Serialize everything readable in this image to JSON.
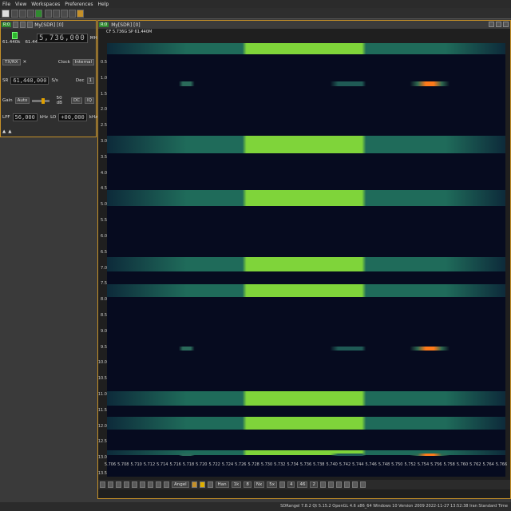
{
  "menu": [
    "File",
    "View",
    "Workspaces",
    "Preferences",
    "Help"
  ],
  "device": {
    "title": "My[SDR] [0]",
    "freq_left": "61.440k",
    "freq_right": "61.440k",
    "frequency": "5,736,000",
    "freq_unit": "MHz",
    "mode": "TX/RX",
    "clock_label": "Clock",
    "clock_value": "Internal",
    "sr_label": "SR",
    "sr_value": "61,440,000",
    "sr_unit": "S/s",
    "dec_label": "Dec",
    "dec_value": "1",
    "gain_label": "Gain",
    "gain_mode": "Auto",
    "gain_value": "50 dB",
    "dc_label": "DC",
    "iq_label": "IQ",
    "lpf_label": "LPF",
    "lpf_value": "56,000",
    "lpf_unit": "kHz",
    "lo_label": "LO",
    "lo_value": "+00,000",
    "lo_unit": "kHz"
  },
  "spectrum": {
    "title": "My[SDR] [0]",
    "info": "CF 5.736G SP 61.440M",
    "y_ticks": [
      "0.5",
      "1.0",
      "1.5",
      "2.0",
      "2.5",
      "3.0",
      "3.5",
      "4.0",
      "4.5",
      "5.0",
      "5.5",
      "6.0",
      "6.5",
      "7.0",
      "7.5",
      "8.0",
      "8.5",
      "9.0",
      "9.5",
      "10.0",
      "10.5",
      "11.0",
      "11.5",
      "12.0",
      "12.5",
      "13.0",
      "13.5"
    ],
    "x_ticks": [
      "5.706",
      "5.708",
      "5.710",
      "5.712",
      "5.714",
      "5.716",
      "5.718",
      "5.720",
      "5.722",
      "5.724",
      "5.726",
      "5.728",
      "5.730",
      "5.732",
      "5.734",
      "5.736",
      "5.738",
      "5.740",
      "5.742",
      "5.744",
      "5.746",
      "5.748",
      "5.750",
      "5.752",
      "5.754",
      "5.756",
      "5.758",
      "5.760",
      "5.762",
      "5.764",
      "5.766"
    ],
    "toolbar": {
      "angle_label": "Angel",
      "window": "Han",
      "fft": "1k",
      "avg_a": "8",
      "avg_b": "Nx",
      "avg_c": "5x",
      "ref": "4",
      "range": "46",
      "step": "2"
    }
  },
  "colors": {
    "accent": "#c59028",
    "band_bright": "#7fd43a",
    "band_dim": "#1f6b5a",
    "background": "#060b1f",
    "hot": "#ff7a1a"
  },
  "status_bar": "SDRangel 7.8.2 Qt 5.15.2 OpenGL 4.6 x86_64 Windows 10 Version 2009 2022-11-27 13:52:38 Iran Standard Time"
}
